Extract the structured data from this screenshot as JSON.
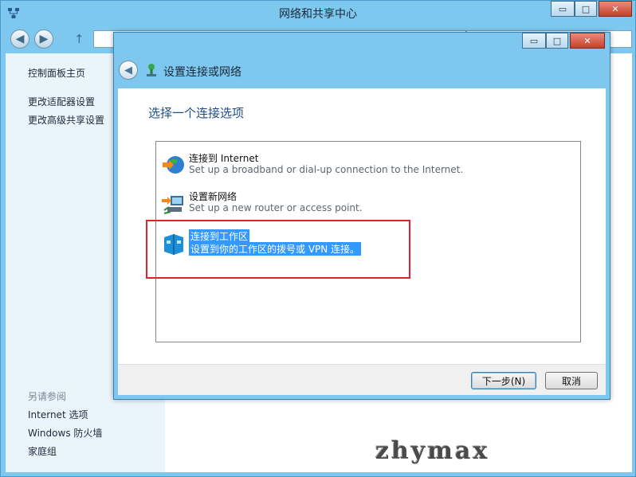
{
  "parent_window": {
    "title": "网络和共享中心",
    "buttons": {
      "minimize": "▭",
      "maximize": "□",
      "close": "✕"
    },
    "sidebar": {
      "links": [
        "控制面板主页",
        "更改适配器设置",
        "更改高级共享设置"
      ],
      "see_also_heading": "另请参阅",
      "see_also": [
        "Internet 选项",
        "Windows 防火墙",
        "家庭组"
      ]
    }
  },
  "dialog": {
    "title": "设置连接或网络",
    "buttons": {
      "minimize": "▭",
      "maximize": "□",
      "close": "✕"
    },
    "heading": "选择一个连接选项",
    "options": [
      {
        "title": "连接到 Internet",
        "description": "Set up a broadband or dial-up connection to the Internet.",
        "icon": "globe-icon"
      },
      {
        "title": "设置新网络",
        "description": "Set up a new router or access point.",
        "icon": "network-setup-icon"
      },
      {
        "title": "连接到工作区",
        "description": "设置到你的工作区的拨号或 VPN 连接。",
        "icon": "workplace-icon"
      }
    ],
    "selected_option_index": 2,
    "next_button": "下一步(N)",
    "cancel_button": "取消"
  },
  "watermark": "zhymax",
  "colors": {
    "frame": "#7ec8ef",
    "selection": "#3399ff",
    "highlight_box": "#e0202a",
    "heading": "#1e4e8a"
  }
}
